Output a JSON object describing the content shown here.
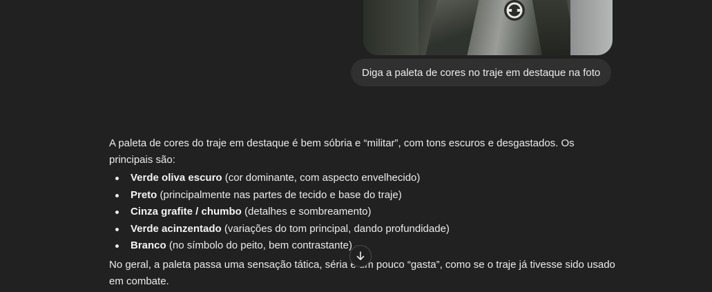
{
  "user_message": {
    "image_alt": "uploaded photo of suit",
    "text": "Diga a paleta de cores no traje em destaque na foto"
  },
  "assistant_message": {
    "intro": "A paleta de cores do traje em destaque é bem sóbria e “militar”, com tons escuros e desgastados. Os principais são:",
    "items": [
      {
        "bold": "Verde oliva escuro",
        "rest": " (cor dominante, com aspecto envelhecido)"
      },
      {
        "bold": "Preto",
        "rest": " (principalmente nas partes de tecido e base do traje)"
      },
      {
        "bold": "Cinza grafite / chumbo",
        "rest": " (detalhes e sombreamento)"
      },
      {
        "bold": "Verde acinzentado",
        "rest": " (variações do tom principal, dando profundidade)"
      },
      {
        "bold": "Branco",
        "rest": " (no símbolo do peito, bem contrastante)"
      }
    ],
    "conclusion": "No geral, a paleta passa uma sensação tática, séria e um pouco “gasta”, como se o traje já tivesse sido usado em combate."
  },
  "controls": {
    "scroll_down_icon": "arrow-down-icon"
  },
  "colors": {
    "background": "#212121",
    "user_bubble": "#303030",
    "text": "#ececec"
  }
}
